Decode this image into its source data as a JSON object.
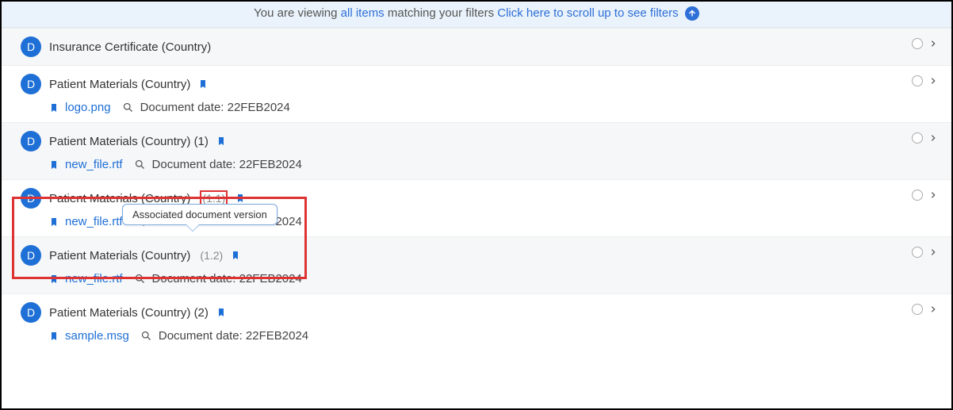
{
  "banner": {
    "text_prefix": "You are viewing ",
    "link1": "all items",
    "text_mid": " matching your filters ",
    "link2": "Click here to scroll up to see filters"
  },
  "badge_letter": "D",
  "tooltip_text": "Associated document version",
  "rows": [
    {
      "title": "Insurance Certificate (Country)",
      "version": "",
      "bookmark": false,
      "file": "",
      "docdate": "",
      "alt": true
    },
    {
      "title": "Patient Materials (Country)",
      "version": "",
      "bookmark": true,
      "file": "logo.png",
      "docdate": "Document date: 22FEB2024",
      "alt": false
    },
    {
      "title": "Patient Materials (Country) (1)",
      "version": "",
      "bookmark": true,
      "file": "new_file.rtf",
      "docdate": "Document date: 22FEB2024",
      "alt": true
    },
    {
      "title": "Patient Materials (Country)",
      "version": "(1.1)",
      "version_boxed": true,
      "bookmark": true,
      "file": "new_file.rtf",
      "docdate": "Document date: 22FEB2024",
      "alt": false
    },
    {
      "title": "Patient Materials (Country)",
      "version": "(1.2)",
      "bookmark": true,
      "file": "new_file.rtf",
      "docdate": "Document date: 22FEB2024",
      "alt": true
    },
    {
      "title": "Patient Materials (Country) (2)",
      "version": "",
      "bookmark": true,
      "file": "sample.msg",
      "docdate": "Document date: 22FEB2024",
      "alt": false
    }
  ]
}
